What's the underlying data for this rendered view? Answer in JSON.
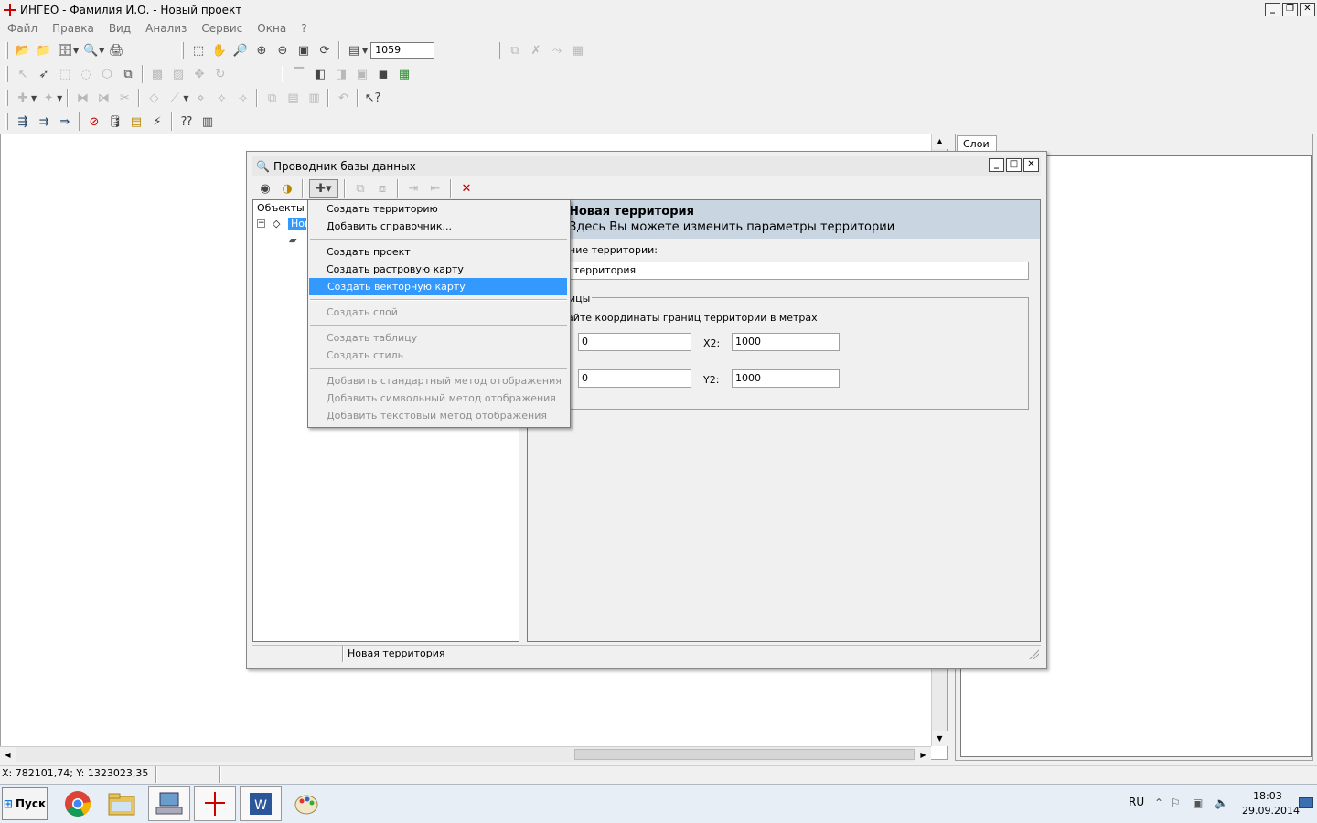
{
  "window": {
    "title": "ИНГЕО - Фамилия И.О. - Новый проект",
    "controls": [
      "_",
      "❐",
      "✕"
    ]
  },
  "menu": [
    "Файл",
    "Правка",
    "Вид",
    "Анализ",
    "Сервис",
    "Окна",
    "?"
  ],
  "toolbar": {
    "scale_value": "1059"
  },
  "layers_panel": {
    "tab_label": "Слои"
  },
  "statusbar": {
    "coords": "X: 782101,74; Y: 1323023,35"
  },
  "dialog": {
    "title": "Проводник базы данных",
    "tree_header": "Объекты",
    "tree_node_label": "Нов",
    "header_title": "Новая территория",
    "header_subtitle": "Здесь Вы можете изменить параметры территории",
    "name_label": "ние территории:",
    "name_value": "территория",
    "group_label": "ицы",
    "group_hint": "айте координаты границ территории в метрах",
    "x1_value": "0",
    "x2_label": "X2:",
    "x2_value": "1000",
    "y1_value": "0",
    "y2_label": "Y2:",
    "y2_value": "1000",
    "status_text": "Новая территория"
  },
  "context_menu": {
    "items": [
      {
        "label": "Создать территорию",
        "enabled": true
      },
      {
        "label": "Добавить справочник...",
        "enabled": true
      },
      {
        "label": "Создать проект",
        "enabled": true
      },
      {
        "label": "Создать растровую карту",
        "enabled": true
      },
      {
        "label": "Создать векторную карту",
        "enabled": true,
        "selected": true
      },
      {
        "label": "Создать слой",
        "enabled": false
      },
      {
        "label": "Создать таблицу",
        "enabled": false
      },
      {
        "label": "Создать стиль",
        "enabled": false
      },
      {
        "label": "Добавить стандартный метод отображения",
        "enabled": false
      },
      {
        "label": "Добавить символьный метод отображения",
        "enabled": false
      },
      {
        "label": "Добавить текстовый метод отображения",
        "enabled": false
      }
    ]
  },
  "taskbar": {
    "start_label": "Пуск",
    "language": "RU",
    "time": "18:03",
    "date": "29.09.2014"
  },
  "colors": {
    "selection": "#3399ff",
    "header_band": "#c9d5e1",
    "app_icon": "#cc0000"
  }
}
